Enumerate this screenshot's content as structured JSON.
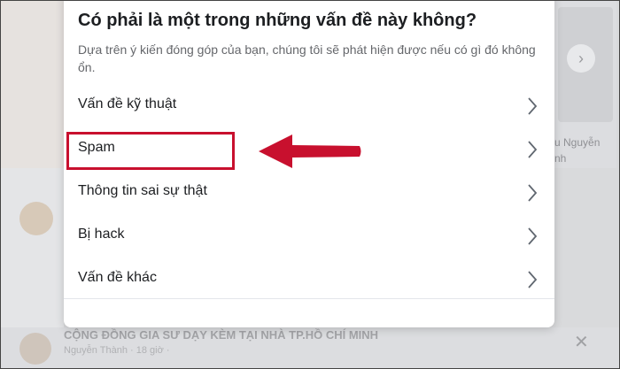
{
  "dialog": {
    "title": "Có phải là một trong những vấn đề này không?",
    "description": "Dựa trên ý kiến đóng góp của bạn, chúng tôi sẽ phát hiện được nếu có gì đó không ổn.",
    "options": [
      {
        "label": "Vấn đề kỹ thuật",
        "icon": "chevron-right-icon"
      },
      {
        "label": "Spam",
        "icon": "chevron-right-icon"
      },
      {
        "label": "Thông tin sai sự thật",
        "icon": "chevron-right-icon"
      },
      {
        "label": "Bị hack",
        "icon": "chevron-right-icon"
      },
      {
        "label": "Vấn đề khác",
        "icon": "chevron-right-icon"
      }
    ]
  },
  "background": {
    "right_name": "u Nguyễn",
    "right_name2": "nh",
    "bottom_title": "CỘNG ĐỒNG GIA SƯ DẠY KÈM TẠI NHÀ TP.HỒ CHÍ MINH",
    "bottom_sub": "Nguyễn Thành · 18 giờ · ",
    "next_icon": "chevron-right-icon",
    "close_icon": "close-icon"
  },
  "annotation": {
    "highlight_color": "#c8102e",
    "arrow_icon": "left-arrow-icon"
  }
}
